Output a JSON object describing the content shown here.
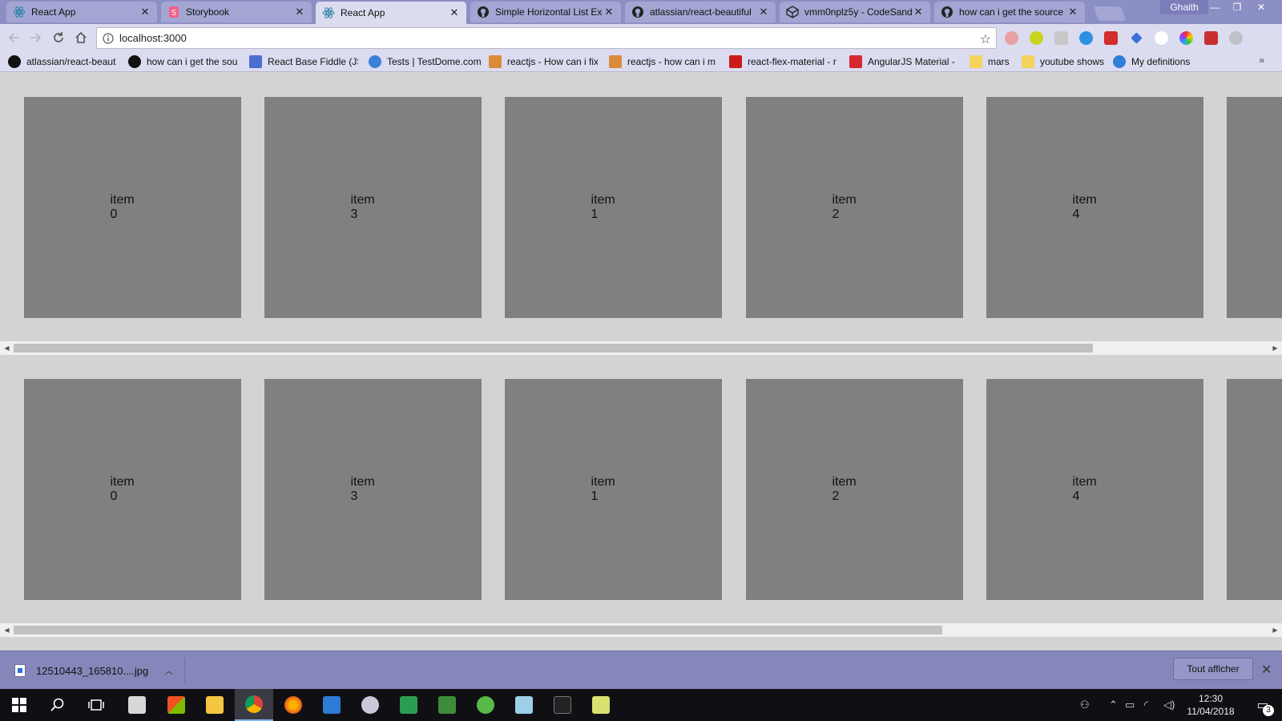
{
  "browser": {
    "tabs": [
      {
        "label": "React App",
        "icon": "react-icon",
        "active": false
      },
      {
        "label": "Storybook",
        "icon": "storybook-icon",
        "active": false
      },
      {
        "label": "React App",
        "icon": "react-icon",
        "active": true
      },
      {
        "label": "Simple Horizontal List Ex",
        "icon": "github-icon",
        "active": false
      },
      {
        "label": "atlassian/react-beautiful",
        "icon": "github-icon",
        "active": false
      },
      {
        "label": "vmm0nplz5y - CodeSand",
        "icon": "codesandbox-icon",
        "active": false
      },
      {
        "label": "how can i get the source",
        "icon": "github-icon",
        "active": false
      }
    ],
    "profile_name": "Ghaith",
    "address": {
      "url": "localhost:3000"
    },
    "bookmarks": [
      {
        "label": "atlassian/react-beaut",
        "icon": "github-icon",
        "color": "#111111"
      },
      {
        "label": "how can i get the sou",
        "icon": "github-icon",
        "color": "#111111"
      },
      {
        "label": "React Base Fiddle (JS",
        "icon": "jsfiddle-icon",
        "color": "#4a6fd0"
      },
      {
        "label": "Tests | TestDome.com",
        "icon": "testdome-icon",
        "color": "#3b7fd6"
      },
      {
        "label": "reactjs - How can i fix",
        "icon": "stackoverflow-icon",
        "color": "#d98b3a"
      },
      {
        "label": "reactjs - how can i m",
        "icon": "stackoverflow-icon",
        "color": "#d98b3a"
      },
      {
        "label": "react-flex-material - r",
        "icon": "npm-icon",
        "color": "#cb1a1a"
      },
      {
        "label": "AngularJS Material - ",
        "icon": "angular-icon",
        "color": "#d6282f"
      },
      {
        "label": "mars",
        "icon": "folder-icon",
        "color": "#f3d35b"
      },
      {
        "label": "youtube shows",
        "icon": "folder-icon",
        "color": "#f3d35b"
      },
      {
        "label": "My definitions",
        "icon": "definitions-icon",
        "color": "#2f7fd6"
      }
    ]
  },
  "lists": [
    {
      "items": [
        {
          "word": "item",
          "num": "0"
        },
        {
          "word": "item",
          "num": "3"
        },
        {
          "word": "item",
          "num": "1"
        },
        {
          "word": "item",
          "num": "2"
        },
        {
          "word": "item",
          "num": "4"
        }
      ],
      "scroll_fraction": 0.86
    },
    {
      "items": [
        {
          "word": "item",
          "num": "0"
        },
        {
          "word": "item",
          "num": "3"
        },
        {
          "word": "item",
          "num": "1"
        },
        {
          "word": "item",
          "num": "2"
        },
        {
          "word": "item",
          "num": "4"
        }
      ],
      "scroll_fraction": 0.74
    }
  ],
  "downloads": {
    "file_name": "12510443_165810....jpg",
    "show_all_label": "Tout afficher"
  },
  "taskbar": {
    "time": "12:30",
    "date": "11/04/2018",
    "notification_count": "3"
  }
}
